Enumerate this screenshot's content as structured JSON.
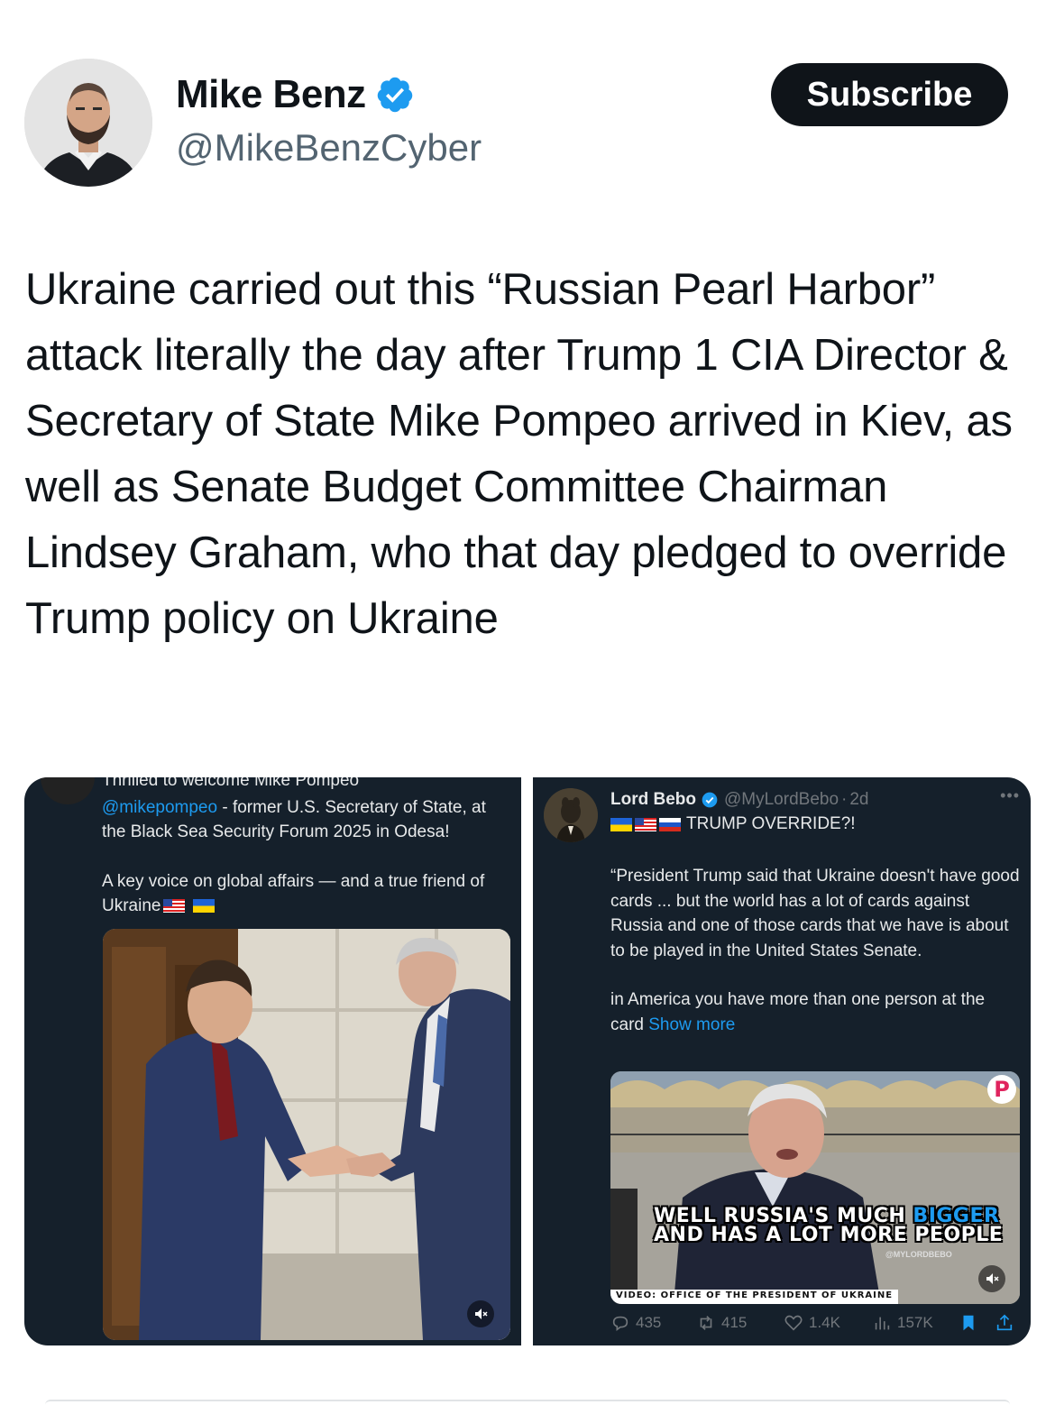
{
  "author": {
    "display_name": "Mike Benz",
    "handle": "@MikeBenzCyber",
    "verified": true
  },
  "subscribe_label": "Subscribe",
  "tweet": {
    "text": "Ukraine carried out this “Russian Pearl Harbor” attack literally the day after Trump 1 CIA Director & Secretary of State Mike Pompeo arrived in Kiev, as well as Senate Budget Committee Chairman Lindsey Graham, who that day pledged to override Trump policy on Ukraine"
  },
  "left_card": {
    "clipped_line": "Thrilled to welcome Mike Pompeo",
    "mention": "@mikepompeo",
    "line1_rest": " - former U.S. Secretary of State, at the Black Sea Security Forum 2025 in Odesa!",
    "line2": "A key voice on global affairs — and a true friend of Ukraine",
    "flags": [
      "us-flag",
      "ua-flag"
    ]
  },
  "right_card": {
    "name": "Lord Bebo",
    "handle": "@MyLordBebo",
    "time": "2d",
    "flags": [
      "ua-flag",
      "us-flag",
      "ru-flag"
    ],
    "subtitle": "TRUMP OVERRIDE?!",
    "body_p1": "“President Trump said that Ukraine doesn't have good cards ... but the world has a lot of cards against Russia and one of those cards that we have is about to be played in the United States Senate.",
    "body_p2": "in America you have more than one person at the card",
    "show_more": "Show more",
    "video": {
      "caption_line1_a": "WELL RUSSIA'S MUCH ",
      "caption_line1_b": "BIGGER",
      "caption_line2": "AND HAS A LOT MORE PEOPLE",
      "watermark": "@MYLORDBEBO",
      "credit": "VIDEO: OFFICE OF THE PRESIDENT OF UKRAINE",
      "badge": "P"
    },
    "stats": {
      "replies": "435",
      "reposts": "415",
      "likes": "1.4K",
      "views": "157K"
    }
  },
  "colors": {
    "accent": "#1d9bf0",
    "dark_panel": "#15202b",
    "button_bg": "#0f1419"
  }
}
